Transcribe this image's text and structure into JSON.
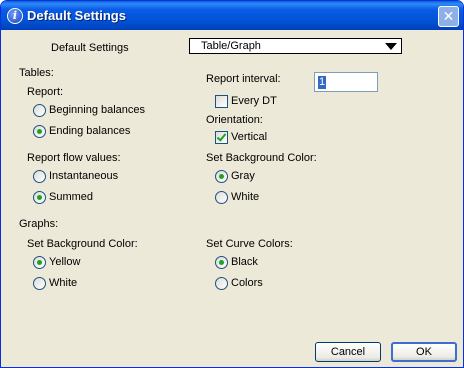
{
  "window": {
    "title": "Default Settings",
    "icon": "info-icon",
    "close_glyph": "✕"
  },
  "header": {
    "label": "Default Settings",
    "dropdown_value": "Table/Graph"
  },
  "tables": {
    "title": "Tables:",
    "report": {
      "label": "Report:",
      "options": [
        {
          "label": "Beginning balances",
          "selected": false
        },
        {
          "label": "Ending balances",
          "selected": true
        }
      ]
    },
    "flow": {
      "label": "Report flow values:",
      "options": [
        {
          "label": "Instantaneous",
          "selected": false
        },
        {
          "label": "Summed",
          "selected": true
        }
      ]
    },
    "interval": {
      "label": "Report interval:",
      "value": "1",
      "every_dt_label": "Every DT",
      "every_dt_checked": false
    },
    "orientation": {
      "label": "Orientation:",
      "vertical_label": "Vertical",
      "vertical_checked": true
    },
    "background": {
      "label": "Set Background Color:",
      "options": [
        {
          "label": "Gray",
          "selected": true
        },
        {
          "label": "White",
          "selected": false
        }
      ]
    }
  },
  "graphs": {
    "title": "Graphs:",
    "background": {
      "label": "Set Background Color:",
      "options": [
        {
          "label": "Yellow",
          "selected": true
        },
        {
          "label": "White",
          "selected": false
        }
      ]
    },
    "curves": {
      "label": "Set Curve Colors:",
      "options": [
        {
          "label": "Black",
          "selected": true
        },
        {
          "label": "Colors",
          "selected": false
        }
      ]
    }
  },
  "buttons": {
    "cancel": "Cancel",
    "ok": "OK"
  },
  "colors": {
    "titlebar": "#0153d6",
    "dialog_bg": "#ece9d8",
    "check_green": "#21a121"
  }
}
